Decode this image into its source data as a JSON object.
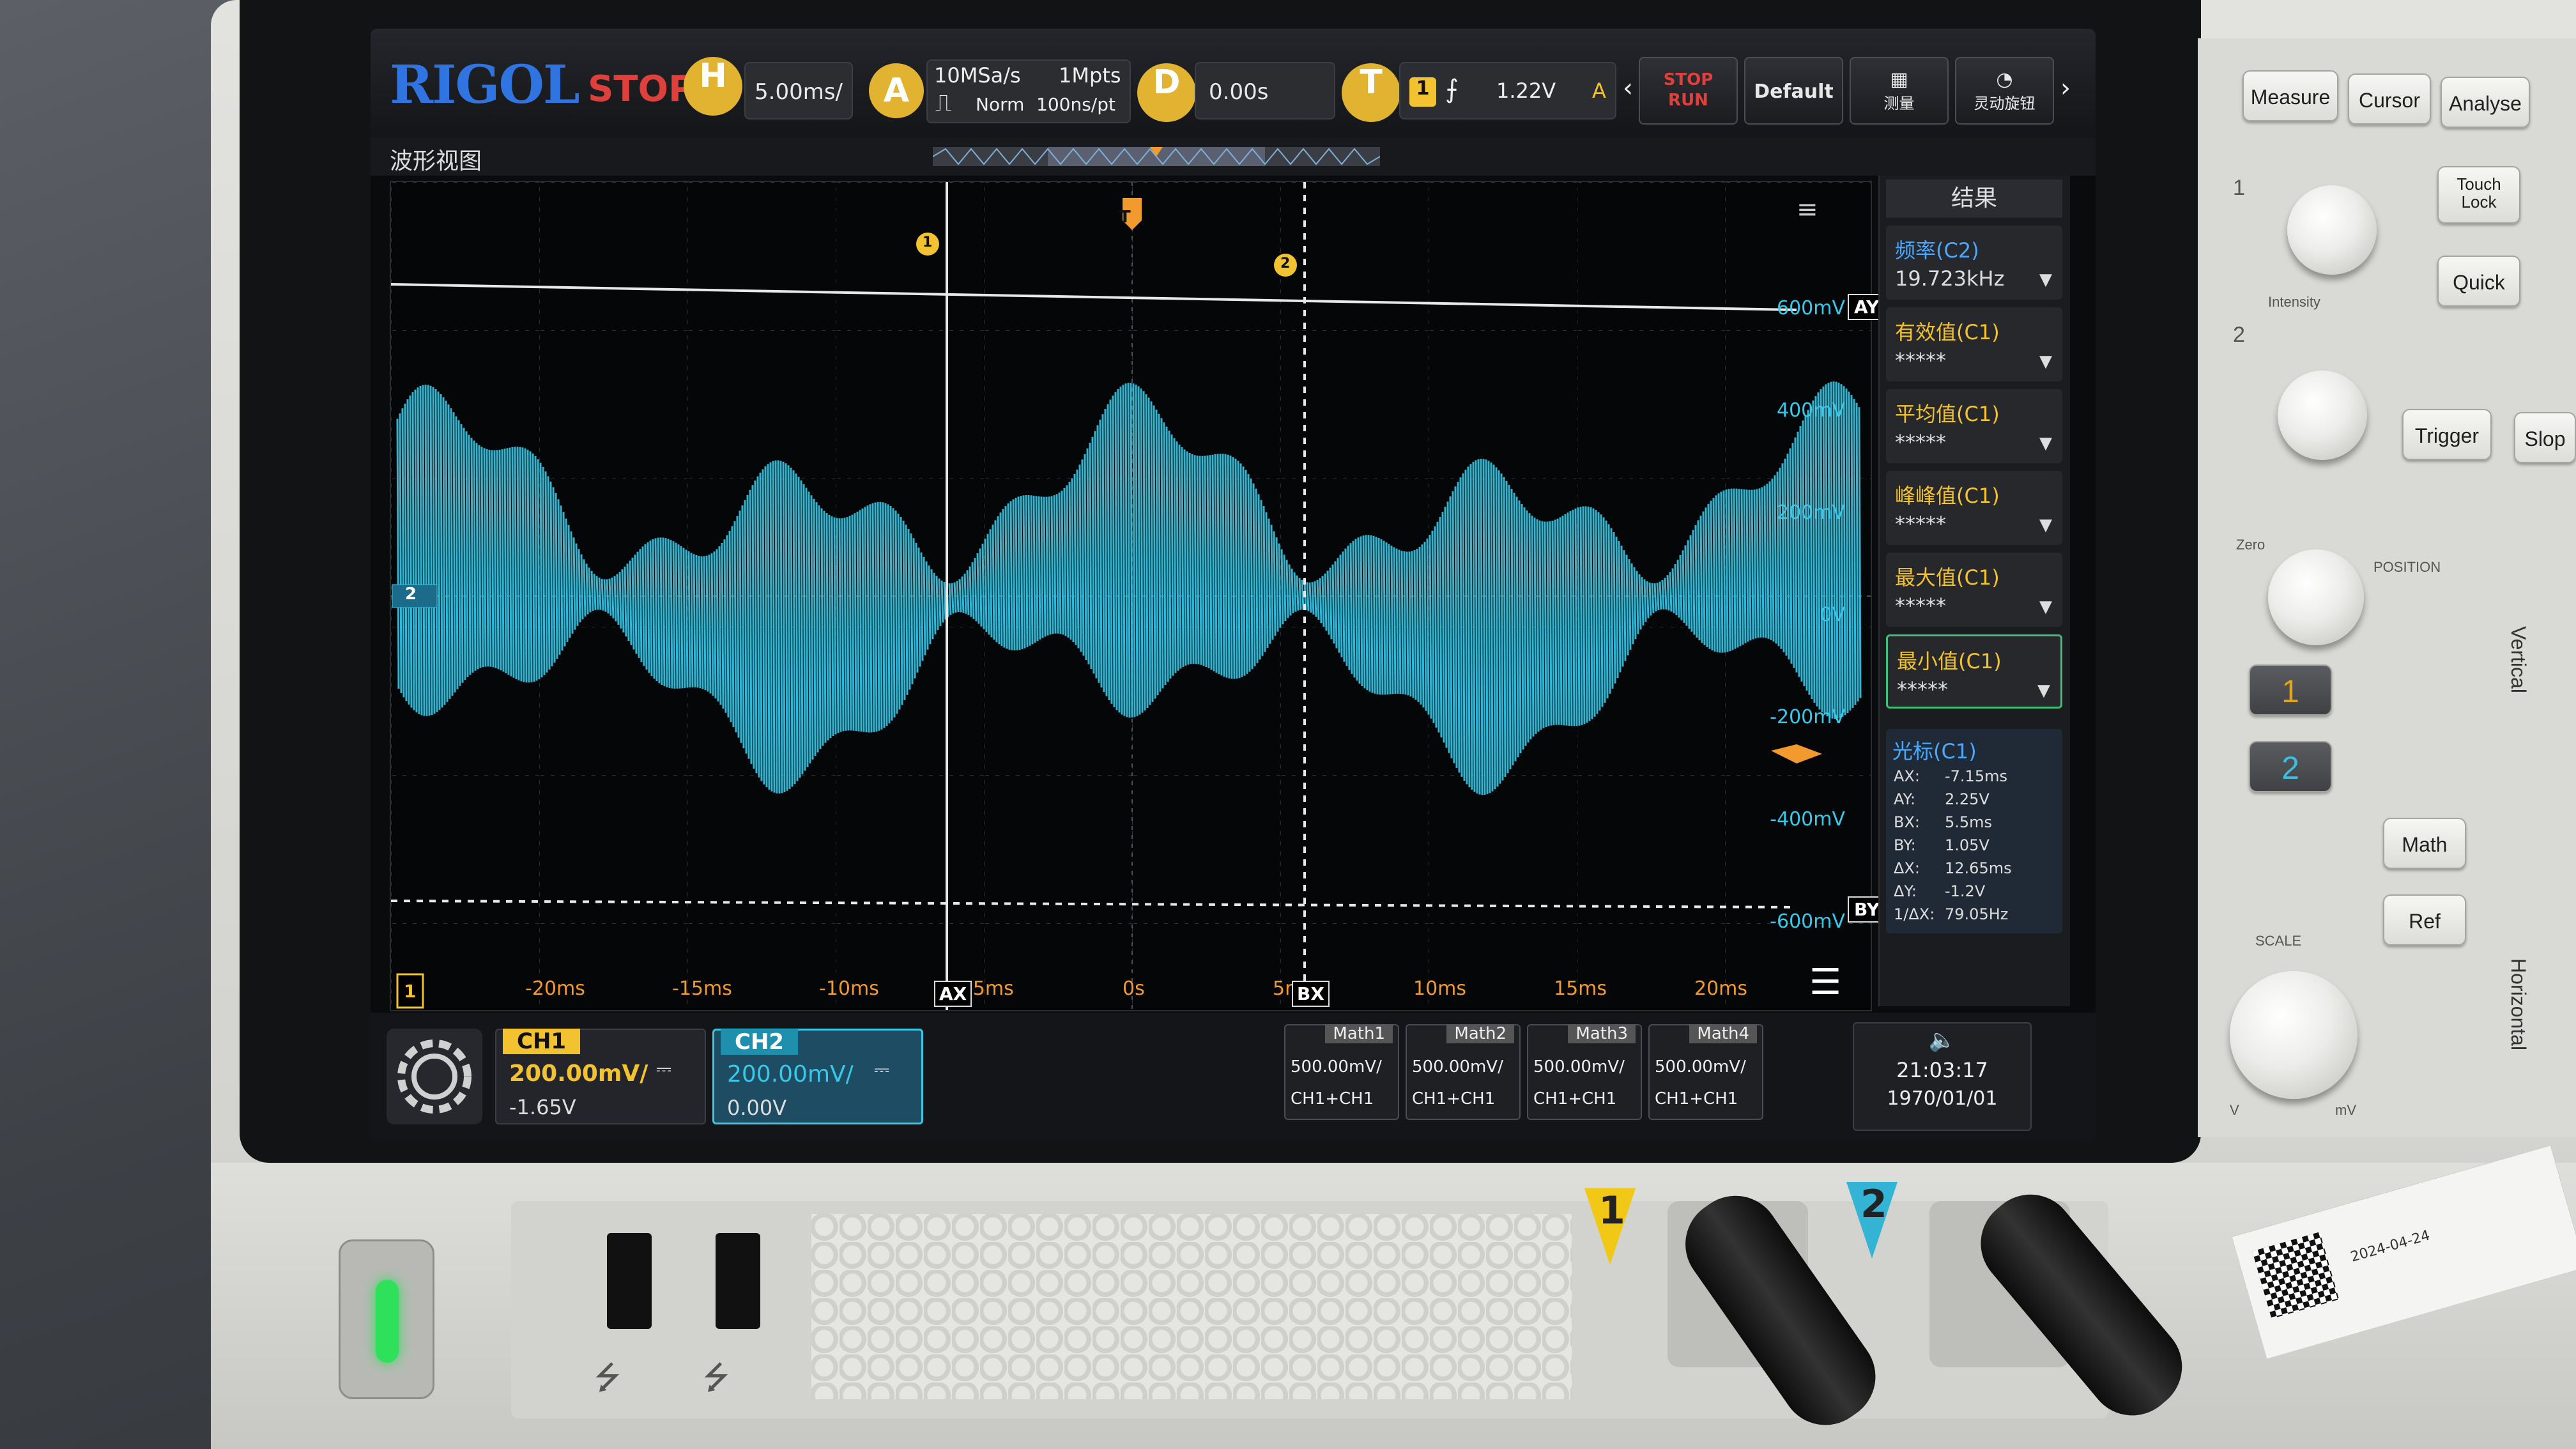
{
  "topbar": {
    "logo": "RIGOL",
    "run_state": "STOP",
    "h_label": "H",
    "timebase": "5.00ms/",
    "a_label": "A",
    "sample_rate": "10MSa/s",
    "mem_depth": "1Mpts",
    "acq_mode": "Norm",
    "sample_interval": "100ns/pt",
    "d_label": "D",
    "delay": "0.00s",
    "t_label": "T",
    "trigger_channel": "1",
    "trigger_level": "1.22V",
    "trigger_mode": "A",
    "btn_stoprun": "STOP RUN",
    "btn_default": "Default",
    "btn_measure": "测量",
    "btn_flex": "灵动旋钮"
  },
  "tab_title": "波形视图",
  "waveform": {
    "x_ticks": [
      "-20ms",
      "-15ms",
      "-10ms",
      "-5ms",
      "0s",
      "5ms",
      "10ms",
      "15ms",
      "20ms"
    ],
    "y_labels": [
      "600mV",
      "400mV",
      "200mV",
      "0V",
      "-200mV",
      "-400mV",
      "-600mV"
    ],
    "cursor_ax": "AX",
    "cursor_bx": "BX",
    "cursor_ay": "AY",
    "cursor_by": "BY",
    "ch2_marker": "2",
    "ch1_marker": "1",
    "trig_marker": "T",
    "cursor1_tag": "1",
    "cursor2_tag": "2"
  },
  "results": {
    "title": "结果",
    "items": [
      {
        "label": "频率(C2)",
        "value": "19.723kHz",
        "color": "#4aa8ff"
      },
      {
        "label": "有效值(C1)",
        "value": "*****",
        "color": "#f2c230"
      },
      {
        "label": "平均值(C1)",
        "value": "*****",
        "color": "#f2c230"
      },
      {
        "label": "峰峰值(C1)",
        "value": "*****",
        "color": "#f2c230"
      },
      {
        "label": "最大值(C1)",
        "value": "*****",
        "color": "#f2c230"
      },
      {
        "label": "最小值(C1)",
        "value": "*****",
        "color": "#f2c230"
      }
    ],
    "cursor_title": "光标(C1)",
    "cursor_rows": [
      {
        "k": "AX:",
        "v": "-7.15ms"
      },
      {
        "k": "AY:",
        "v": "2.25V"
      },
      {
        "k": "BX:",
        "v": "5.5ms"
      },
      {
        "k": "BY:",
        "v": "1.05V"
      },
      {
        "k": "ΔX:",
        "v": "12.65ms"
      },
      {
        "k": "ΔY:",
        "v": "-1.2V"
      },
      {
        "k": "1/ΔX:",
        "v": "79.05Hz"
      }
    ]
  },
  "bottombar": {
    "ch1": {
      "name": "CH1",
      "scale": "200.00mV/",
      "offset": "-1.65V"
    },
    "ch2": {
      "name": "CH2",
      "scale": "200.00mV/",
      "offset": "0.00V"
    },
    "maths": [
      {
        "name": "Math1",
        "scale": "500.00mV/",
        "src": "CH1+CH1"
      },
      {
        "name": "Math2",
        "scale": "500.00mV/",
        "src": "CH1+CH1"
      },
      {
        "name": "Math3",
        "scale": "500.00mV/",
        "src": "CH1+CH1"
      },
      {
        "name": "Math4",
        "scale": "500.00mV/",
        "src": "CH1+CH1"
      }
    ],
    "time": "21:03:17",
    "date": "1970/01/01"
  },
  "panel": {
    "measure": "Measure",
    "cursor": "Cursor",
    "analyse": "Analyse",
    "touch_lock": "Touch Lock",
    "quick": "Quick",
    "intensity": "Intensity",
    "trigger": "Trigger",
    "slope": "Slop",
    "position": "POSITION",
    "vertical": "Vertical",
    "ch1_btn": "1",
    "ch2_btn": "2",
    "math": "Math",
    "ref": "Ref",
    "scale": "SCALE",
    "horizontal": "Horizontal",
    "v_label": "V",
    "mv_label": "mV",
    "zero": "Zero",
    "knob_num1": "1",
    "knob_num2": "2"
  },
  "front": {
    "port1": "1",
    "port2": "2",
    "label_date": "2024-04-24"
  },
  "colors": {
    "ch1": "#f2c230",
    "ch2": "#38c8e8",
    "accent": "#2f74e0",
    "stop": "#e0403c"
  }
}
